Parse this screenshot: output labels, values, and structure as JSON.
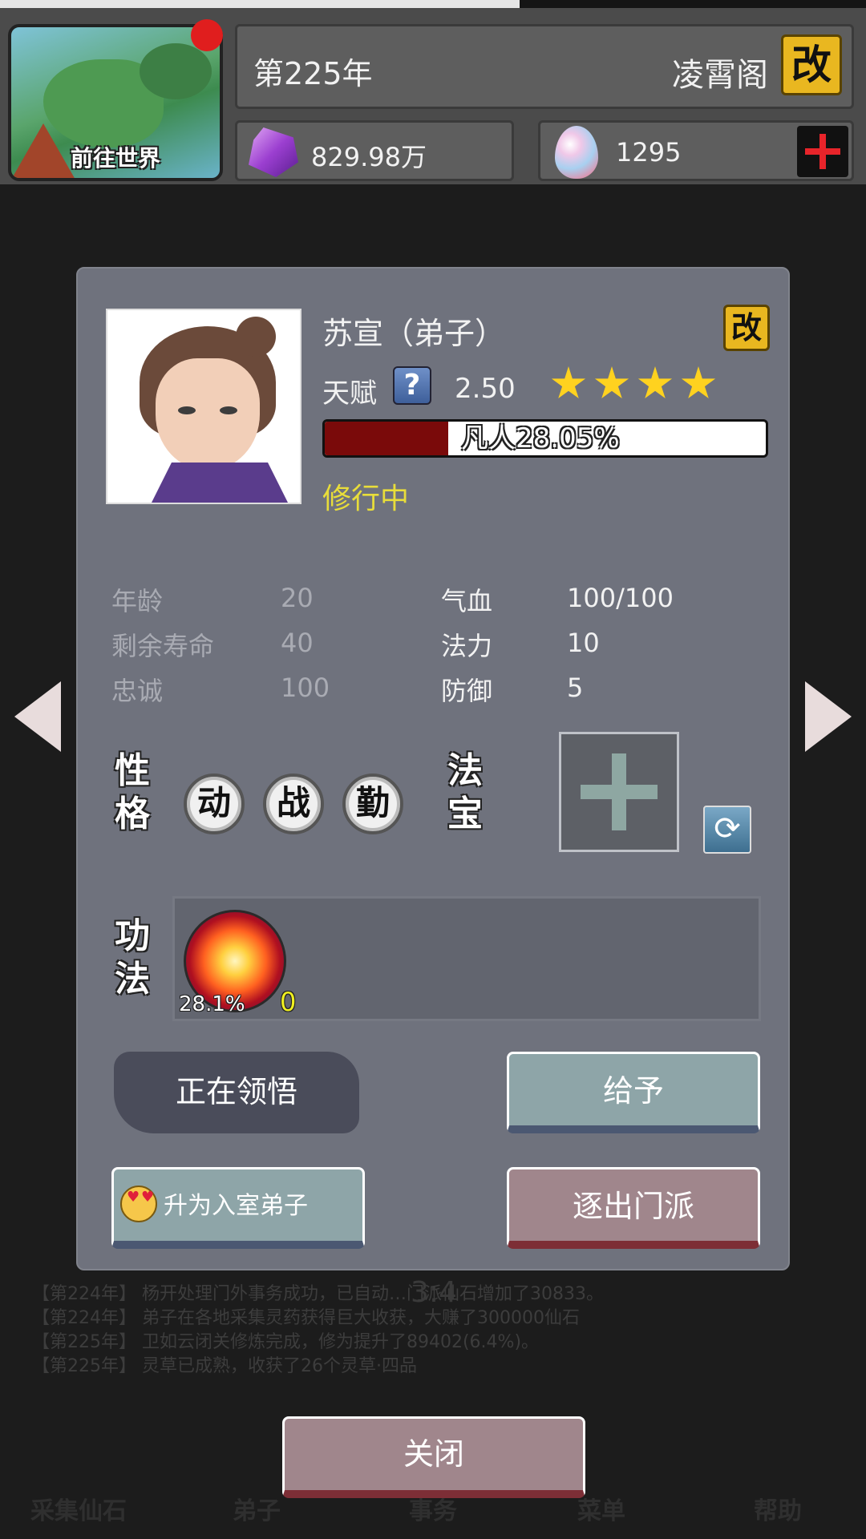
{
  "header": {
    "world_button_label": "前往世界",
    "year": "第225年",
    "sect_name": "凌霄阁",
    "rename_label": "改",
    "spirit_stones": "829.98万",
    "spirit_eggs": "1295"
  },
  "disciple": {
    "name": "苏宣（弟子）",
    "rename_label": "改",
    "talent_label": "天赋",
    "help_label": "?",
    "talent_value": "2.50",
    "stars": 4,
    "realm_text": "凡人28.05%",
    "realm_progress": 0.2805,
    "status": "修行中",
    "stats_left": [
      {
        "label": "年龄",
        "value": "20"
      },
      {
        "label": "剩余寿命",
        "value": "40"
      },
      {
        "label": "忠诚",
        "value": "100"
      }
    ],
    "stats_right": [
      {
        "label": "气血",
        "value": "100/100"
      },
      {
        "label": "法力",
        "value": "10"
      },
      {
        "label": "防御",
        "value": "5"
      }
    ],
    "personality_label": "性格",
    "traits": [
      "动",
      "战",
      "勤"
    ],
    "treasure_label": "法宝",
    "skill_label": "功法",
    "skill_progress": "28.1%",
    "skill_level": "0"
  },
  "actions": {
    "comprehending": "正在领悟",
    "give": "给予",
    "promote": "升为入室弟子",
    "expel": "逐出门派",
    "close": "关闭"
  },
  "ratio_text": "3:4",
  "background_log": [
    "【第224年】 杨开处理门外事务成功，已自动…门派仙石增加了30833。",
    "【第224年】 弟子在各地采集灵药获得巨大收获，大赚了300000仙石",
    "【第225年】 卫如云闭关修炼完成，修为提升了89402(6.4%)。",
    "【第225年】 灵草已成熟，收获了26个灵草·四品"
  ],
  "bottom_nav": [
    "采集仙石",
    "弟子",
    "事务",
    "菜单",
    "帮助"
  ],
  "colors": {
    "rename_bg": "#e9b720",
    "status": "#e8dd3a",
    "star": "#ffd21f",
    "realm_fill": "#7a0a0a"
  }
}
